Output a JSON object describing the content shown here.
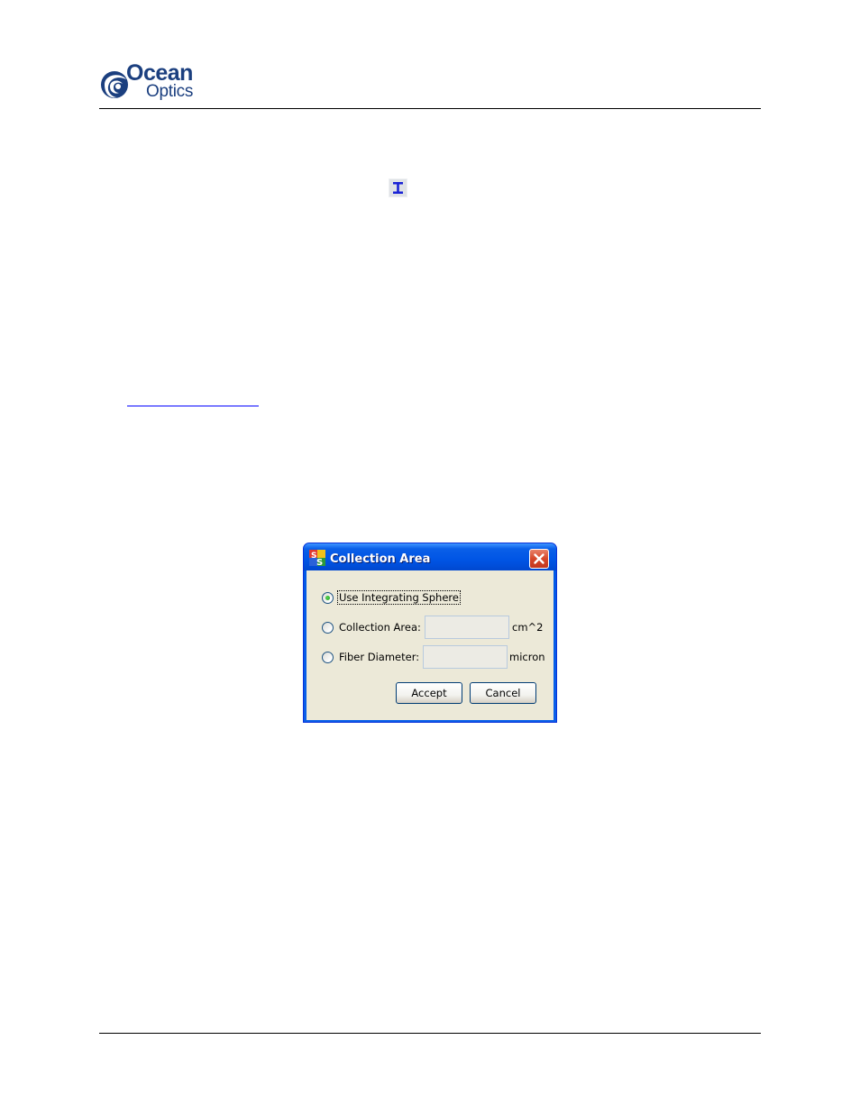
{
  "header": {
    "logo": {
      "line1": "Ocean",
      "line2": "Optics",
      "brand_color": "#1b3f7f"
    }
  },
  "toolbar_icon": {
    "name": "integrating-sphere-tool-icon",
    "glyph": "I"
  },
  "dialog": {
    "title": "Collection Area",
    "app_icon": "spectrasuite-icon",
    "close_icon": "close-icon",
    "options": {
      "integrating_sphere": {
        "label": "Use Integrating Sphere",
        "selected": true
      },
      "collection_area": {
        "label": "Collection Area:",
        "value": "",
        "unit": "cm^2",
        "selected": false
      },
      "fiber_diameter": {
        "label": "Fiber Diameter:",
        "value": "",
        "unit": "micron",
        "selected": false
      }
    },
    "buttons": {
      "accept": "Accept",
      "cancel": "Cancel"
    },
    "colors": {
      "titlebar": "#0055e5",
      "body": "#ece9d8",
      "close": "#d6472b"
    }
  }
}
